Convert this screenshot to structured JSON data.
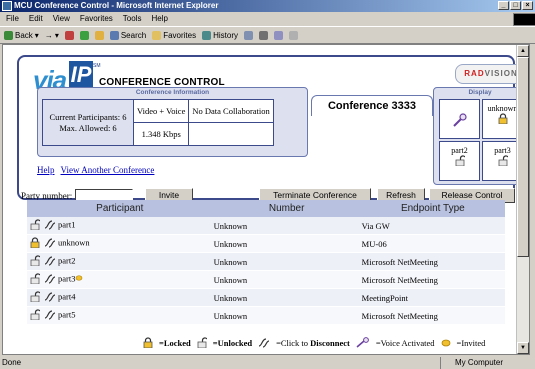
{
  "window": {
    "title": "MCU Conference Control - Microsoft Internet Explorer"
  },
  "menu": [
    "File",
    "Edit",
    "View",
    "Favorites",
    "Tools",
    "Help"
  ],
  "toolbar": {
    "back": "Back",
    "forward": "→",
    "search": "Search",
    "favorites": "Favorites",
    "history": "History"
  },
  "brand": {
    "via": "via",
    "ip": "IP",
    "sm": "SM",
    "title": "CONFERENCE CONTROL",
    "vendor_a": "RAD",
    "vendor_b": "VISION"
  },
  "info": {
    "header": "Conference Information",
    "current": "Current Participants: 6",
    "max": "Max. Allowed: 6",
    "mode": "Video + Voice",
    "rate": "1.348 Kbps",
    "collab": "No Data Collaboration"
  },
  "conference_label": "Conference 3333",
  "display": {
    "header": "Display",
    "cells": [
      {
        "label": "",
        "icon": "voice-activated-icon"
      },
      {
        "label": "unknown",
        "icon": "locked-icon"
      },
      {
        "label": "part2",
        "icon": "unlocked-icon"
      },
      {
        "label": "part3",
        "icon": "unlocked-icon"
      }
    ]
  },
  "links": {
    "help": "Help",
    "view_another": "View Another Conference"
  },
  "actions": {
    "party_label": "Party number:",
    "party_value": "",
    "invite": "Invite",
    "terminate": "Terminate Conference",
    "refresh": "Refresh",
    "release": "Release Control"
  },
  "table": {
    "headers": [
      "Participant",
      "Number",
      "Endpoint Type"
    ],
    "rows": [
      {
        "name": "part1",
        "number": "Unknown",
        "endpoint": "Via GW",
        "locked": false,
        "invited": false
      },
      {
        "name": "unknown",
        "number": "Unknown",
        "endpoint": "MU-06",
        "locked": true,
        "invited": false
      },
      {
        "name": "part2",
        "number": "Unknown",
        "endpoint": "Microsoft NetMeeting",
        "locked": false,
        "invited": false
      },
      {
        "name": "part3",
        "number": "Unknown",
        "endpoint": "Microsoft NetMeeting",
        "locked": false,
        "invited": true
      },
      {
        "name": "part4",
        "number": "Unknown",
        "endpoint": "MeetingPoint",
        "locked": false,
        "invited": false
      },
      {
        "name": "part5",
        "number": "Unknown",
        "endpoint": "Microsoft NetMeeting",
        "locked": false,
        "invited": false
      }
    ]
  },
  "legend": {
    "locked": "=Locked",
    "unlocked": "=Unlocked",
    "disconnect_a": "=Click to ",
    "disconnect_b": "Disconnect",
    "voice": "=Voice Activated",
    "invited": "=Invited"
  },
  "status": {
    "left": "Done",
    "zone": "My Computer"
  },
  "colors": {
    "panel_border": "#3c4a8c",
    "header_bg": "#b8c2e0",
    "link": "#0000c0",
    "title_gradient_start": "#0a246a"
  }
}
